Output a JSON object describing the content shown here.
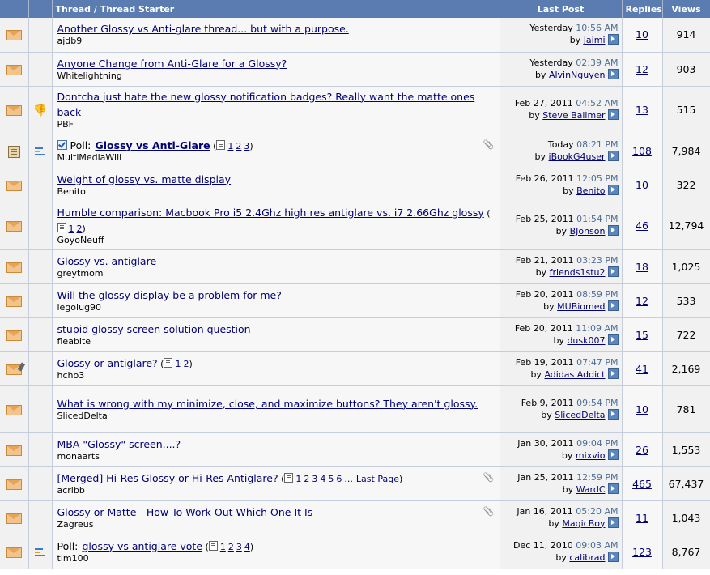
{
  "headers": {
    "thread": "Thread / Thread Starter",
    "lastpost": "Last Post",
    "replies": "Replies",
    "views": "Views"
  },
  "icons": {
    "status": "envelope-icon",
    "paperclip": "paperclip-icon",
    "go_last": "go-to-last-post-icon",
    "thumbs_down": "thumbs-down-icon",
    "poll": "poll-icon",
    "multipage": "multipage-icon"
  },
  "colors": {
    "header_bg": "#5b7cb0",
    "link": "#000077",
    "time": "#4e6e95",
    "row_bg": "#f7f7f7"
  },
  "threads": [
    {
      "title": "Another Glossy vs Anti-glare thread... but with a purpose.",
      "starter": "ajdb9",
      "date": "Yesterday",
      "time": "10:56 AM",
      "by": "by",
      "lastposter": "Jaimi",
      "replies": "10",
      "views": "914"
    },
    {
      "title": "Anyone Change from Anti-Glare for a Glossy?",
      "starter": "Whitelightning",
      "date": "Yesterday",
      "time": "02:39 AM",
      "by": "by",
      "lastposter": "AlvinNguyen",
      "replies": "12",
      "views": "903"
    },
    {
      "title": "Dontcha just hate the new glossy notification badges? Really want the matte ones back",
      "starter": "PBF",
      "date": "Feb 27, 2011",
      "time": "04:52 AM",
      "by": "by",
      "lastposter": "Steve Ballmer",
      "replies": "13",
      "views": "515"
    },
    {
      "prefix": "Poll:",
      "title": "Glossy vs Anti-Glare",
      "starter": "MultiMediaWill",
      "pages": [
        "1",
        "2",
        "3"
      ],
      "date": "Today",
      "time": "08:21 PM",
      "by": "by",
      "lastposter": "iBookG4user",
      "replies": "108",
      "views": "7,984"
    },
    {
      "title": "Weight of glossy vs. matte display",
      "starter": "Benito",
      "date": "Feb 26, 2011",
      "time": "12:05 PM",
      "by": "by",
      "lastposter": "Benito",
      "replies": "10",
      "views": "322"
    },
    {
      "title": "Humble comparison: Macbook Pro i5 2.4Ghz high res antiglare vs. i7 2.66Ghz glossy",
      "starter": "GoyoNeuff",
      "pages": [
        "1",
        "2"
      ],
      "date": "Feb 25, 2011",
      "time": "01:54 PM",
      "by": "by",
      "lastposter": "BJonson",
      "replies": "46",
      "views": "12,794"
    },
    {
      "title": "Glossy vs. antiglare",
      "starter": "greytmom",
      "date": "Feb 21, 2011",
      "time": "03:23 PM",
      "by": "by",
      "lastposter": "friends1stu2",
      "replies": "18",
      "views": "1,025"
    },
    {
      "title": "Will the glossy display be a problem for me?",
      "starter": "legolug90",
      "date": "Feb 20, 2011",
      "time": "08:59 PM",
      "by": "by",
      "lastposter": "MUBiomed",
      "replies": "12",
      "views": "533"
    },
    {
      "title": "stupid glossy screen solution question",
      "starter": "fleabite",
      "date": "Feb 20, 2011",
      "time": "11:09 AM",
      "by": "by",
      "lastposter": "dusk007",
      "replies": "15",
      "views": "722"
    },
    {
      "title": "Glossy or antiglare?",
      "starter": "hcho3",
      "pages": [
        "1",
        "2"
      ],
      "date": "Feb 19, 2011",
      "time": "07:47 PM",
      "by": "by",
      "lastposter": "Adidas Addict",
      "replies": "41",
      "views": "2,169"
    },
    {
      "title": "What is wrong with my minimize, close, and maximize buttons? They aren't glossy.",
      "starter": "SlicedDelta",
      "date": "Feb 9, 2011",
      "time": "09:54 PM",
      "by": "by",
      "lastposter": "SlicedDelta",
      "replies": "10",
      "views": "781"
    },
    {
      "title": "MBA \"Glossy\" screen....?",
      "starter": "monaarts",
      "date": "Jan 30, 2011",
      "time": "09:04 PM",
      "by": "by",
      "lastposter": "mixvio",
      "replies": "26",
      "views": "1,553"
    },
    {
      "title": "[Merged] Hi-Res Glossy or Hi-Res Antiglare?",
      "starter": "acribb",
      "pages": [
        "1",
        "2",
        "3",
        "4",
        "5",
        "6"
      ],
      "pages_more": "...",
      "pages_last": "Last Page",
      "date": "Jan 25, 2011",
      "time": "12:59 PM",
      "by": "by",
      "lastposter": "WardC",
      "replies": "465",
      "views": "67,437"
    },
    {
      "title": "Glossy or Matte - How To Work Out Which One It Is",
      "starter": "Zagreus",
      "date": "Jan 16, 2011",
      "time": "05:20 AM",
      "by": "by",
      "lastposter": "MagicBoy",
      "replies": "11",
      "views": "1,043"
    },
    {
      "prefix": "Poll:",
      "title": "glossy vs antiglare vote",
      "starter": "tim100",
      "pages": [
        "1",
        "2",
        "3",
        "4"
      ],
      "date": "Dec 11, 2010",
      "time": "09:03 AM",
      "by": "by",
      "lastposter": "calibrad",
      "replies": "123",
      "views": "8,767"
    }
  ]
}
